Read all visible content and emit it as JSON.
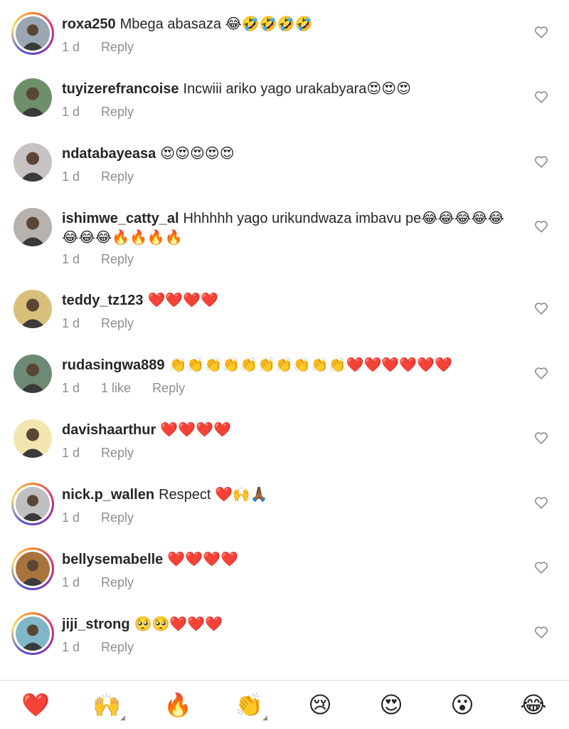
{
  "comments": [
    {
      "username": "roxa250",
      "text": "Mbega abasaza 😂🤣🤣🤣🤣",
      "time": "1 d",
      "likes": "",
      "reply": "Reply",
      "avatar": "ring",
      "bg": "#9aa7b3"
    },
    {
      "username": "tuyizerefrancoise",
      "text": "Incwiii ariko yago urakabyara😍😍😍",
      "time": "1 d",
      "likes": "",
      "reply": "Reply",
      "avatar": "plain",
      "bg": "#6f8f6a"
    },
    {
      "username": "ndatabayeasa",
      "text": "😍😍😍😍😍",
      "time": "1 d",
      "likes": "",
      "reply": "Reply",
      "avatar": "plain",
      "bg": "#c9c2c5"
    },
    {
      "username": "ishimwe_catty_al",
      "text": "Hhhhhh yago urikundwaza imbavu pe😂😂😂😂😂😂😂😂🔥🔥🔥🔥",
      "time": "1 d",
      "likes": "",
      "reply": "Reply",
      "avatar": "plain",
      "bg": "#b7b2ae"
    },
    {
      "username": "teddy_tz123",
      "text": "❤️❤️❤️❤️",
      "time": "1 d",
      "likes": "",
      "reply": "Reply",
      "avatar": "plain",
      "bg": "#d8c07a"
    },
    {
      "username": "rudasingwa889",
      "text": "👏👏👏👏👏👏👏👏👏👏❤️❤️❤️❤️❤️❤️",
      "time": "1 d",
      "likes": "1 like",
      "reply": "Reply",
      "avatar": "plain",
      "bg": "#6d8a74"
    },
    {
      "username": "davishaarthur",
      "text": "❤️❤️❤️❤️",
      "time": "1 d",
      "likes": "",
      "reply": "Reply",
      "avatar": "plain",
      "bg": "#f2e6b0"
    },
    {
      "username": "nick.p_wallen",
      "text": "Respect ❤️🙌🙏🏾",
      "time": "1 d",
      "likes": "",
      "reply": "Reply",
      "avatar": "ring",
      "bg": "#bfbfbf"
    },
    {
      "username": "bellysemabelle",
      "text": "❤️❤️❤️❤️",
      "time": "1 d",
      "likes": "",
      "reply": "Reply",
      "avatar": "ring",
      "bg": "#a8743c"
    },
    {
      "username": "jiji_strong",
      "text": "🥺🥺❤️❤️❤️",
      "time": "1 d",
      "likes": "",
      "reply": "Reply",
      "avatar": "ring",
      "bg": "#7fb7c9"
    }
  ],
  "reactions": [
    {
      "emoji": "❤️",
      "name": "heart",
      "more": false
    },
    {
      "emoji": "🙌",
      "name": "raising-hands",
      "more": true
    },
    {
      "emoji": "🔥",
      "name": "fire",
      "more": false
    },
    {
      "emoji": "👏",
      "name": "clapping-hands",
      "more": true
    },
    {
      "emoji": "😢",
      "name": "crying-face",
      "more": false
    },
    {
      "emoji": "😍",
      "name": "heart-eyes",
      "more": false
    },
    {
      "emoji": "😮",
      "name": "surprised-face",
      "more": false
    },
    {
      "emoji": "😂",
      "name": "tears-of-joy",
      "more": false
    }
  ],
  "colors": {
    "text": "#262626",
    "muted": "#8e8e8e",
    "divider": "#dbdbdb"
  }
}
